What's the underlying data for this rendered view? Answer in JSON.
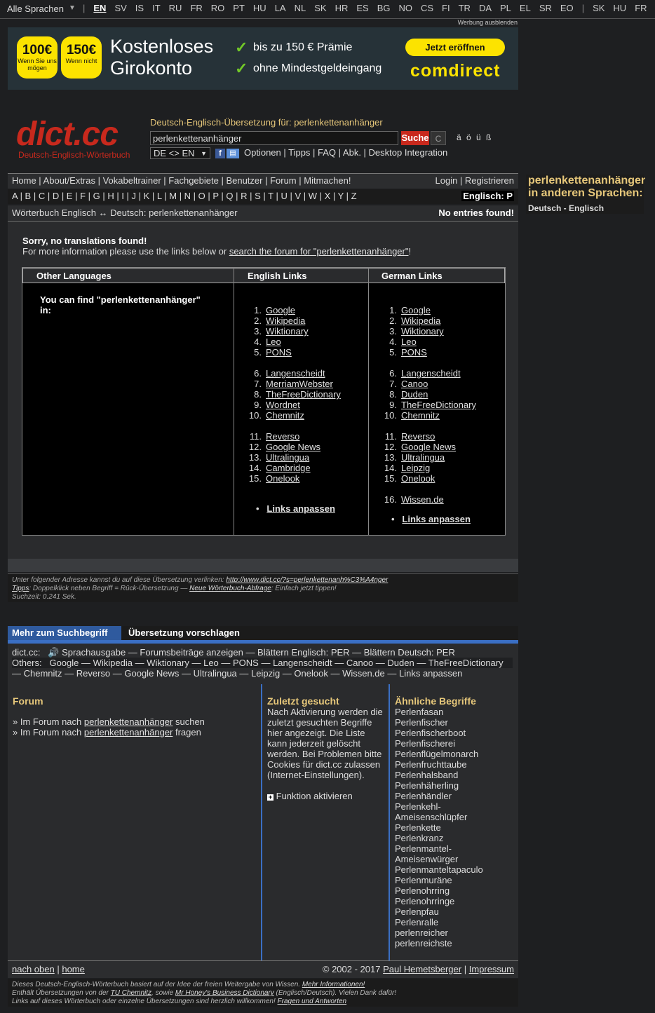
{
  "langbar": {
    "all_label": "Alle Sprachen",
    "languages": [
      "EN",
      "SV",
      "IS",
      "IT",
      "RU",
      "FR",
      "RO",
      "PT",
      "HU",
      "LA",
      "NL",
      "SK",
      "HR",
      "ES",
      "BG",
      "NO",
      "CS",
      "FI",
      "TR",
      "DA",
      "PL",
      "EL",
      "SR",
      "EO"
    ],
    "extra": [
      "SK",
      "HU",
      "FR"
    ],
    "active": "EN",
    "hide_ads": "Werbung ausblenden"
  },
  "ad": {
    "badge1_big": "100€",
    "badge1_small": "Wenn Sie uns mögen",
    "badge2_big": "150€",
    "badge2_small": "Wenn nicht",
    "headline1": "Kostenloses",
    "headline2": "Girokonto",
    "check1": "bis zu 150 € Prämie",
    "check2": "ohne Mindestgeldeingang",
    "cta": "Jetzt eröffnen",
    "brand": "comdirect"
  },
  "header": {
    "logo": "dict.cc",
    "logo_sub": "Deutsch-Englisch-Wörterbuch",
    "title": "Deutsch-Englisch-Übersetzung für: perlenkettenanhänger",
    "search_value": "perlenkettenanhänger",
    "search_button": "Suche",
    "clear_button": "C",
    "umlauts": "ä ö ü ß",
    "direction": "DE <> EN",
    "links": "Optionen | Tipps | FAQ | Abk. | Desktop Integration"
  },
  "nav": {
    "main": "Home | About/Extras | Vokabeltrainer | Fachgebiete | Benutzer | Forum | Mitmachen!",
    "account": "Login | Registrieren",
    "letters": "A | B | C | D | E | F | G | H | I | J | K | L | M | N | O | P | Q | R | S | T | U | V | W | X | Y | Z",
    "letter_mode": "Englisch: P",
    "breadcrumb": "Wörterbuch Englisch ↔ Deutsch: perlenkettenanhänger",
    "status": "No entries found!"
  },
  "side": {
    "title": "perlenkettenanhänger in anderen Sprachen:",
    "subtitle": "Deutsch - Englisch"
  },
  "results": {
    "sorry": "Sorry, no translations found!",
    "more_info_prefix": "For more information please use the links below or ",
    "more_info_link": "search the forum for \"perlenkettenanhänger\"",
    "more_info_suffix": "!",
    "col1_head": "Other Languages",
    "col2_head": "English Links",
    "col3_head": "German Links",
    "find_text": "You can find \"perlenkettenanhänger\" in:",
    "english_links": [
      [
        "1.",
        "Google"
      ],
      [
        "2.",
        "Wikipedia"
      ],
      [
        "3.",
        "Wiktionary"
      ],
      [
        "4.",
        "Leo"
      ],
      [
        "5.",
        "PONS"
      ],
      [
        "6.",
        "Langenscheidt"
      ],
      [
        "7.",
        "MerriamWebster"
      ],
      [
        "8.",
        "TheFreeDictionary"
      ],
      [
        "9.",
        "Wordnet"
      ],
      [
        "10.",
        "Chemnitz"
      ],
      [
        "11.",
        "Reverso"
      ],
      [
        "12.",
        "Google News"
      ],
      [
        "13.",
        "Ultralingua"
      ],
      [
        "14.",
        "Cambridge"
      ],
      [
        "15.",
        "Onelook"
      ]
    ],
    "german_links": [
      [
        "1.",
        "Google"
      ],
      [
        "2.",
        "Wikipedia"
      ],
      [
        "3.",
        "Wiktionary"
      ],
      [
        "4.",
        "Leo"
      ],
      [
        "5.",
        "PONS"
      ],
      [
        "6.",
        "Langenscheidt"
      ],
      [
        "7.",
        "Canoo"
      ],
      [
        "8.",
        "Duden"
      ],
      [
        "9.",
        "TheFreeDictionary"
      ],
      [
        "10.",
        "Chemnitz"
      ],
      [
        "11.",
        "Reverso"
      ],
      [
        "12.",
        "Google News"
      ],
      [
        "13.",
        "Ultralingua"
      ],
      [
        "14.",
        "Leipzig"
      ],
      [
        "15.",
        "Onelook"
      ],
      [
        "16.",
        "Wissen.de"
      ]
    ],
    "adjust_links": "Links anpassen"
  },
  "footnote": {
    "line1_prefix": "Unter folgender Adresse kannst du auf diese Übersetzung verlinken: ",
    "line1_link": "http://www.dict.cc/?s=perlenkettenanh%C3%A4nger",
    "line2_tips": "Tipps",
    "line2_mid": ": Doppelklick neben Begriff = Rück-Übersetzung — ",
    "line2_link": "Neue Wörterbuch-Abfrage",
    "line2_suffix": ": Einfach jetzt tippen!",
    "line3": "Suchzeit: 0.241 Sek."
  },
  "more": {
    "tab1": "Mehr zum Suchbegriff",
    "tab2": "Übersetzung vorschlagen",
    "dictcc_label": "dict.cc:",
    "dictcc_items": "Sprachausgabe — Forumsbeiträge anzeigen — Blättern Englisch: PER — Blättern Deutsch: PER",
    "others_label": "Others:",
    "others_line1": "Google — Wikipedia — Wiktionary — Leo — PONS — Langenscheidt — Canoo — Duden — TheFreeDictionary",
    "others_line2": "— Chemnitz — Reverso — Google News — Ultralingua — Leipzig — Onelook — Wissen.de — Links anpassen",
    "forum_head": "Forum",
    "forum_l1_pre": "» Im Forum nach ",
    "forum_term": "perlenkettenanhänger",
    "forum_l1_suf": " suchen",
    "forum_l2_pre": "» Im Forum nach ",
    "forum_l2_suf": " fragen",
    "recent_head": "Zuletzt gesucht",
    "recent_text": "Nach Aktivierung werden die zuletzt gesuchten Begriffe hier angezeigt. Die Liste kann jederzeit gelöscht werden. Bei Problemen bitte Cookies für dict.cc zulassen (Internet-Einstellungen).",
    "recent_activate": "Funktion aktivieren",
    "similar_head": "Ähnliche Begriffe",
    "similar": [
      "Perlenfasan",
      "Perlenfischer",
      "Perlenfischerboot",
      "Perlenfischerei",
      "Perlenflügelmonarch",
      "Perlenfruchttaube",
      "Perlenhalsband",
      "Perlenhäherling",
      "Perlenhändler",
      "Perlenkehl-",
      "Ameisenschlüpfer",
      "Perlenkette",
      "Perlenkranz",
      "Perlenmantel-",
      "Ameisenwürger",
      "Perlenmanteltapaculo",
      "Perlenmuräne",
      "Perlenohrring",
      "Perlenohrringe",
      "Perlenpfau",
      "Perlenralle",
      "perlenreicher",
      "perlenreichste"
    ]
  },
  "bottom": {
    "top_link": "nach oben",
    "home_link": "home",
    "copyright": "© 2002 - 2017 ",
    "author": "Paul Hemetsberger",
    "impressum": "Impressum",
    "credit1_pre": "Dieses Deutsch-Englisch-Wörterbuch basiert auf der Idee der freien Weitergabe von Wissen. ",
    "credit1_link": "Mehr Informationen!",
    "credit2_pre": "Enthält Übersetzungen von der ",
    "credit2_link1": "TU Chemnitz",
    "credit2_mid": ", sowie ",
    "credit2_link2": "Mr Honey's Business Dictionary",
    "credit2_suf": " (Englisch/Deutsch). Vielen Dank dafür!",
    "credit3_pre": "Links auf dieses Wörterbuch oder einzelne Übersetzungen sind herzlich willkommen! ",
    "credit3_link": "Fragen und Antworten"
  },
  "colors": {
    "accent_red": "#c8291d",
    "accent_gold": "#e6c77a",
    "tab_blue": "#2f5a9e",
    "ad_yellow": "#fce300"
  }
}
